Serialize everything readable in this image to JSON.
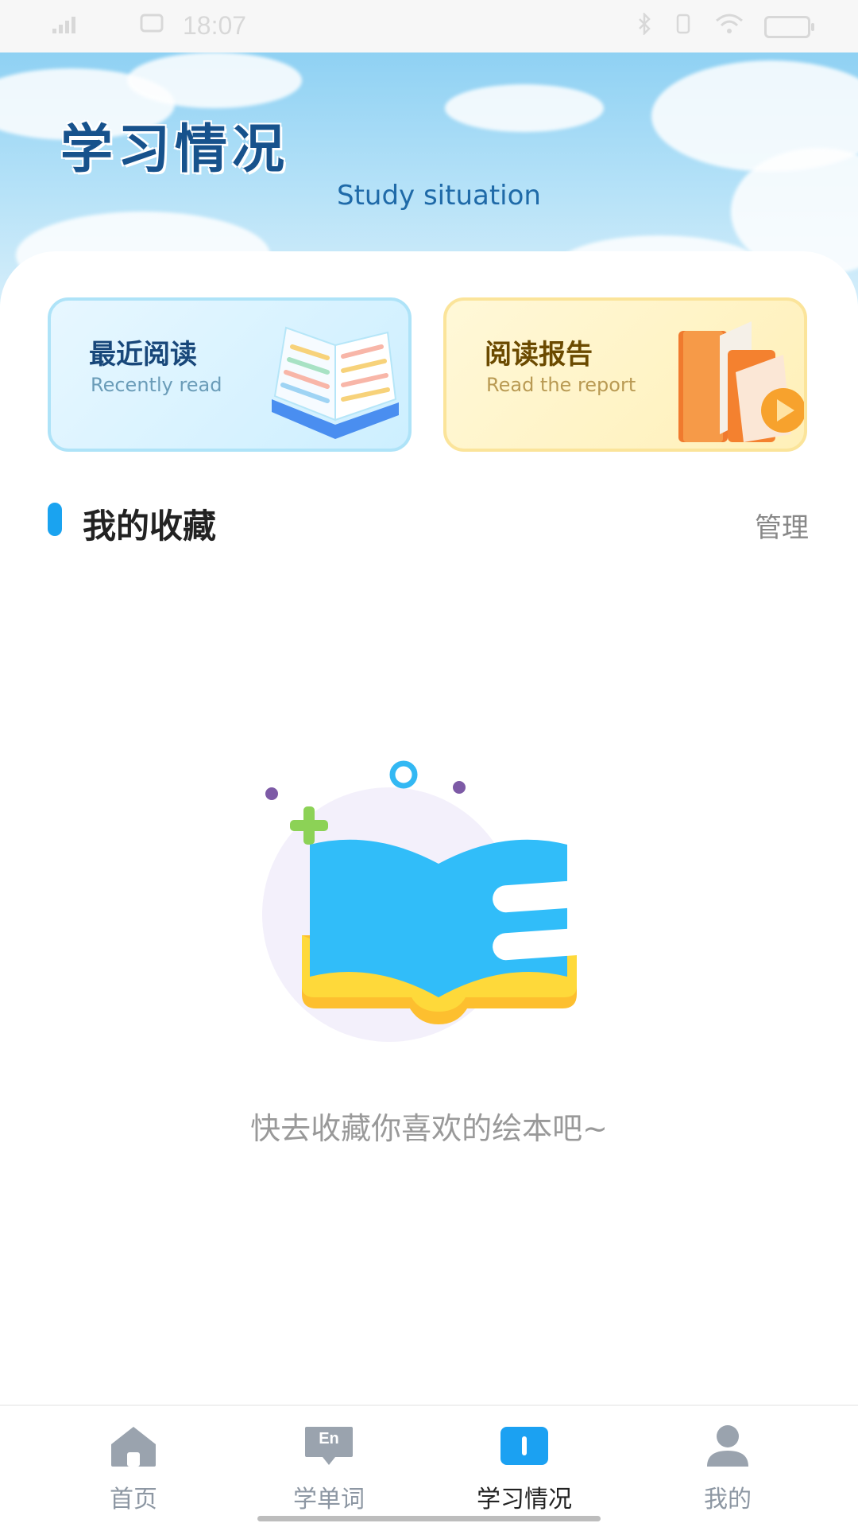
{
  "status_bar": {
    "time": "18:07",
    "signal_icon": "signal-icon",
    "wifi_icon": "wifi-icon",
    "battery_icon": "battery-icon"
  },
  "header": {
    "title": "学习情况",
    "subtitle": "Study situation"
  },
  "cards": {
    "recent": {
      "title": "最近阅读",
      "subtitle": "Recently read",
      "icon": "open-book-icon"
    },
    "report": {
      "title": "阅读报告",
      "subtitle": "Read the report",
      "icon": "books-play-icon"
    }
  },
  "favorites": {
    "title": "我的收藏",
    "manage_label": "管理",
    "empty_message": "快去收藏你喜欢的绘本吧~",
    "empty_icon": "empty-book-icon"
  },
  "bottom_nav": {
    "items": [
      {
        "label": "首页",
        "icon": "home-icon",
        "active": false
      },
      {
        "label": "学单词",
        "icon": "en-word-icon",
        "icon_text": "En",
        "active": false
      },
      {
        "label": "学习情况",
        "icon": "study-icon",
        "active": true
      },
      {
        "label": "我的",
        "icon": "profile-icon",
        "active": false
      }
    ]
  },
  "colors": {
    "title_blue": "#17528c",
    "accent_blue": "#1aa3f0",
    "recent_card_bg": "#d9f3ff",
    "report_card_bg": "#fff4c6",
    "nav_inactive": "#8d97a3",
    "nav_active": "#222222"
  }
}
